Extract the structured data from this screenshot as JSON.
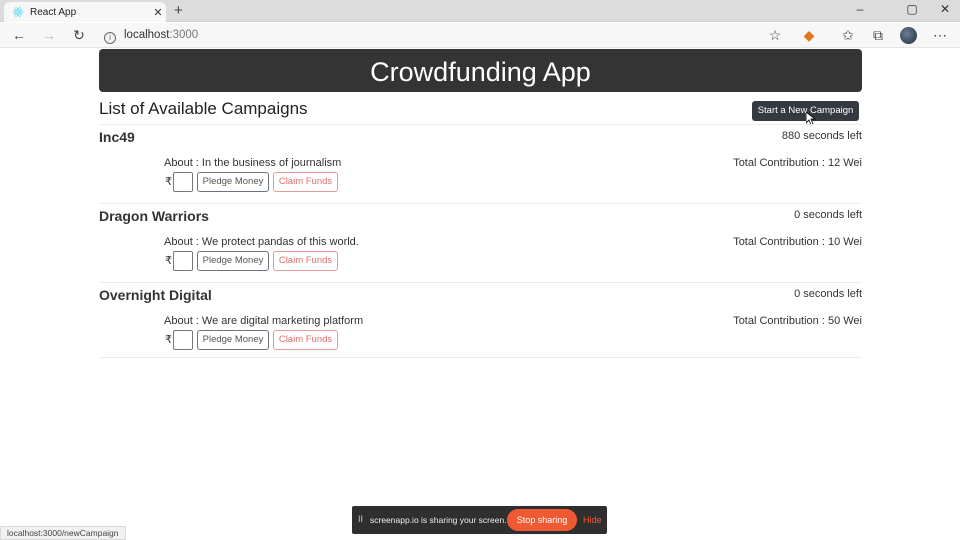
{
  "browser": {
    "tab_title": "React App",
    "new_tab": "+",
    "close_tab": "✕",
    "minimize": "–",
    "maximize": "▢",
    "close_window": "✕",
    "url_host": "localhost",
    "url_port": ":3000",
    "status_url": "localhost:3000/newCampaign"
  },
  "header": {
    "title": "Crowdfunding App"
  },
  "main": {
    "list_title": "List of Available Campaigns",
    "new_campaign_label": "Start a New Campaign",
    "campaigns": [
      {
        "name": "Inc49",
        "time_left": "880 seconds left",
        "about": "About : In the business of journalism",
        "total": "Total Contribution : 12 Wei",
        "currency": "₹",
        "pledge_label": "Pledge Money",
        "claim_label": "Claim Funds"
      },
      {
        "name": "Dragon Warriors",
        "time_left": "0 seconds left",
        "about": "About : We protect pandas of this world.",
        "total": "Total Contribution : 10 Wei",
        "currency": "₹",
        "pledge_label": "Pledge Money",
        "claim_label": "Claim Funds"
      },
      {
        "name": "Overnight Digital",
        "time_left": "0 seconds left",
        "about": "About : We are digital marketing platform",
        "total": "Total Contribution : 50 Wei",
        "currency": "₹",
        "pledge_label": "Pledge Money",
        "claim_label": "Claim Funds"
      }
    ]
  },
  "share_bar": {
    "pause": "II",
    "message": "screenapp.io is sharing your screen.",
    "stop_label": "Stop sharing",
    "hide_label": "Hide"
  },
  "icons": {
    "back": "←",
    "forward": "→",
    "refresh": "↻",
    "info": "i",
    "star": "☆",
    "extension": "◆",
    "favorites": "✩",
    "collections": "⧉",
    "more": "⋯"
  },
  "colors": {
    "banner_bg": "#343434",
    "primary_button": "#343a40",
    "claim_button": "#e06c6c",
    "share_stop": "#ef5a32"
  }
}
